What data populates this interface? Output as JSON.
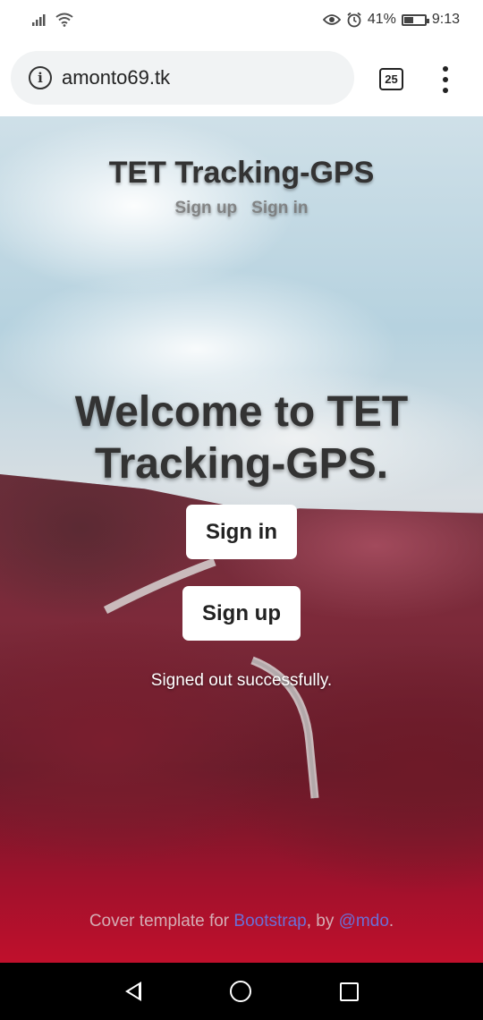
{
  "status_bar": {
    "battery_percent": "41%",
    "time": "9:13",
    "battery_level": 0.41
  },
  "browser": {
    "url": "amonto69.tk",
    "tab_count": "25"
  },
  "hero": {
    "brand": "TET Tracking-GPS",
    "nav": {
      "signup": "Sign up",
      "signin": "Sign in"
    },
    "heading": "Welcome to TET Tracking-GPS.",
    "signin_button": "Sign in",
    "signup_button": "Sign up",
    "flash": "Signed out successfully."
  },
  "footer": {
    "prefix": "Cover template for ",
    "bootstrap_link": "Bootstrap",
    "by": ", by ",
    "author_link": "@mdo",
    "suffix": "."
  },
  "colors": {
    "footer_link": "#6b6fd6"
  }
}
